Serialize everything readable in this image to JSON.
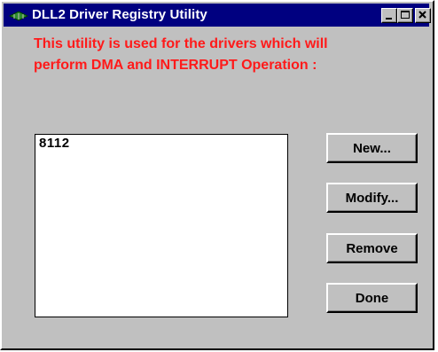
{
  "window": {
    "title": "DLL2 Driver Registry Utility",
    "icons": {
      "app": "chip-icon",
      "minimize": "minimize-icon",
      "maximize": "maximize-icon",
      "close": "close-icon"
    }
  },
  "description": {
    "line1": "This utility is used for the drivers which will",
    "line2": "perform DMA and INTERRUPT Operation :",
    "color": "#ff1a1a"
  },
  "drivers_list": {
    "items": [
      "8112"
    ]
  },
  "buttons": {
    "new": "New...",
    "modify": "Modify...",
    "remove": "Remove",
    "done": "Done"
  },
  "colors": {
    "titlebar": "#000080",
    "face": "#c0c0c0"
  }
}
